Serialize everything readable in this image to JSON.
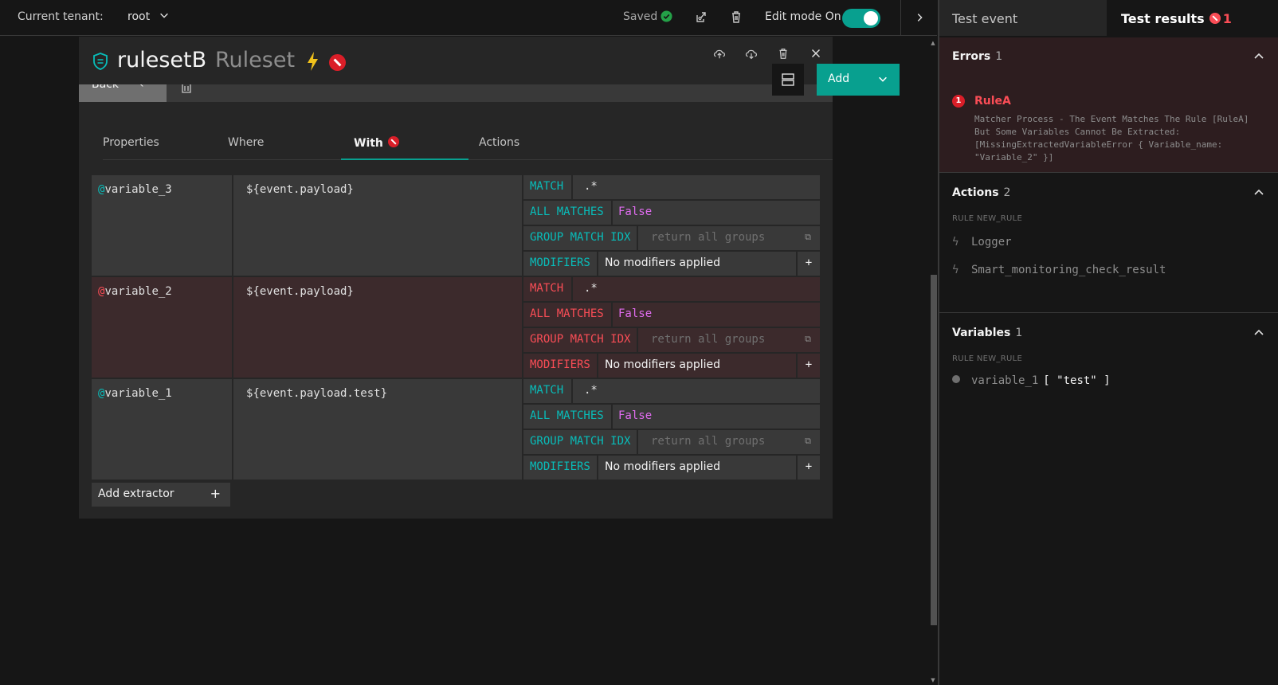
{
  "topbar": {
    "tenant_label": "Current tenant:",
    "tenant_value": "root",
    "saved_label": "Saved",
    "edit_mode_label": "Edit mode On"
  },
  "card": {
    "title": "rulesetB",
    "subtitle": "Ruleset",
    "back_label": "Back",
    "add_label": "Add",
    "tabs": [
      "Properties",
      "Where",
      "With",
      "Actions"
    ],
    "active_tab": "With",
    "add_extractor_label": "Add extractor"
  },
  "extractors": [
    {
      "at": "@",
      "name": "variable_3",
      "source": "${event.payload}",
      "match_key": "MATCH",
      "match_value": ".*",
      "all_matches_key": "ALL MATCHES",
      "all_matches_value": "False",
      "group_key": "GROUP MATCH IDX",
      "group_placeholder": "return all groups",
      "modifiers_key": "MODIFIERS",
      "modifiers_value": "No modifiers applied",
      "has_error": false
    },
    {
      "at": "@",
      "name": "variable_2",
      "source": "${event.payload}",
      "match_key": "MATCH",
      "match_value": ".*",
      "all_matches_key": "ALL MATCHES",
      "all_matches_value": "False",
      "group_key": "GROUP MATCH IDX",
      "group_placeholder": "return all groups",
      "modifiers_key": "MODIFIERS",
      "modifiers_value": "No modifiers applied",
      "has_error": true
    },
    {
      "at": "@",
      "name": "variable_1",
      "source": "${event.payload.test}",
      "match_key": "MATCH",
      "match_value": ".*",
      "all_matches_key": "ALL MATCHES",
      "all_matches_value": "False",
      "group_key": "GROUP MATCH IDX",
      "group_placeholder": "return all groups",
      "modifiers_key": "MODIFIERS",
      "modifiers_value": "No modifiers applied",
      "has_error": false
    }
  ],
  "right_panel": {
    "tab_test_event": "Test event",
    "tab_test_results": "Test results",
    "test_results_error_count": "1",
    "errors": {
      "title": "Errors",
      "count": "1",
      "item_badge": "1",
      "item_title": "RuleA",
      "item_message": "Matcher Process - The Event Matches The Rule [RuleA] But Some Variables Cannot Be Extracted: [MissingExtractedVariableError { Variable_name: \"Variable_2\" }]"
    },
    "actions": {
      "title": "Actions",
      "count": "2",
      "rule_label": "RULE NEW_RULE",
      "items": [
        "Logger",
        "Smart_monitoring_check_result"
      ]
    },
    "variables": {
      "title": "Variables",
      "count": "1",
      "rule_label": "RULE NEW_RULE",
      "item_name": "variable_1",
      "item_value": "[ \"test\" ]"
    }
  },
  "colors": {
    "accent": "#08a08f",
    "error": "#fa4d56",
    "false_value": "#e06cf0"
  }
}
